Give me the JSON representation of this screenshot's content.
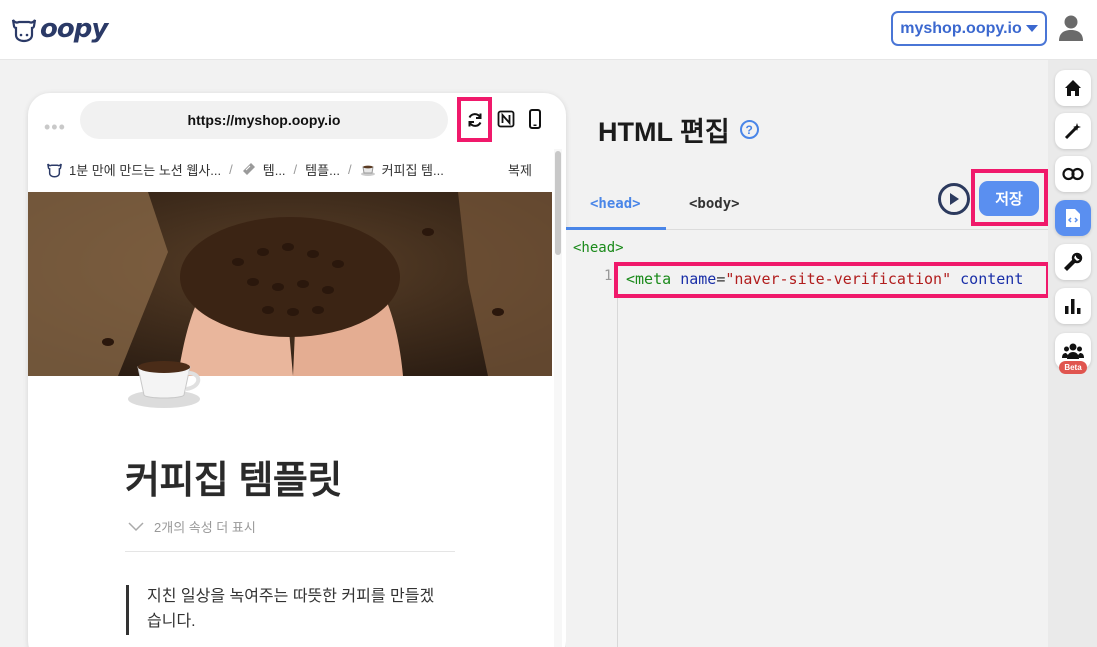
{
  "header": {
    "logo_text": "oopy",
    "site_select_label": "myshop.oopy.io"
  },
  "preview": {
    "url": "https://myshop.oopy.io",
    "breadcrumb": [
      {
        "label": "1분 만에 만드는 노션 웹사..."
      },
      {
        "label": "템..."
      },
      {
        "label": "템플..."
      },
      {
        "label": "커피집 템..."
      }
    ],
    "copy_label": "복제",
    "page_title": "커피집 템플릿",
    "props_toggle": "2개의 속성 더 표시",
    "quote": "지친 일상을 녹여주는 따뜻한 커피를 만들겠습니다."
  },
  "editor": {
    "title": "HTML 편집",
    "tabs": [
      {
        "label": "<head>",
        "active": true
      },
      {
        "label": "<body>",
        "active": false
      }
    ],
    "save_label": "저장",
    "code_head_tag": "<head>",
    "line_number": "1",
    "code": {
      "tag_open": "<meta",
      "attr1": "name",
      "eq": "=",
      "value1": "\"naver-site-verification\"",
      "attr2": "content"
    }
  },
  "sidebar": {
    "items": [
      {
        "name": "home",
        "icon": "home-icon"
      },
      {
        "name": "magic",
        "icon": "magic-wand-icon"
      },
      {
        "name": "link",
        "icon": "link-icon"
      },
      {
        "name": "html",
        "icon": "code-file-icon",
        "active": true
      },
      {
        "name": "tools",
        "icon": "wrench-icon"
      },
      {
        "name": "stats",
        "icon": "bar-chart-icon"
      },
      {
        "name": "community",
        "icon": "users-icon",
        "badge": "Beta"
      }
    ]
  },
  "colors": {
    "accent": "#5a8ff0",
    "highlight": "#f0196b",
    "brand": "#2b3a67"
  }
}
